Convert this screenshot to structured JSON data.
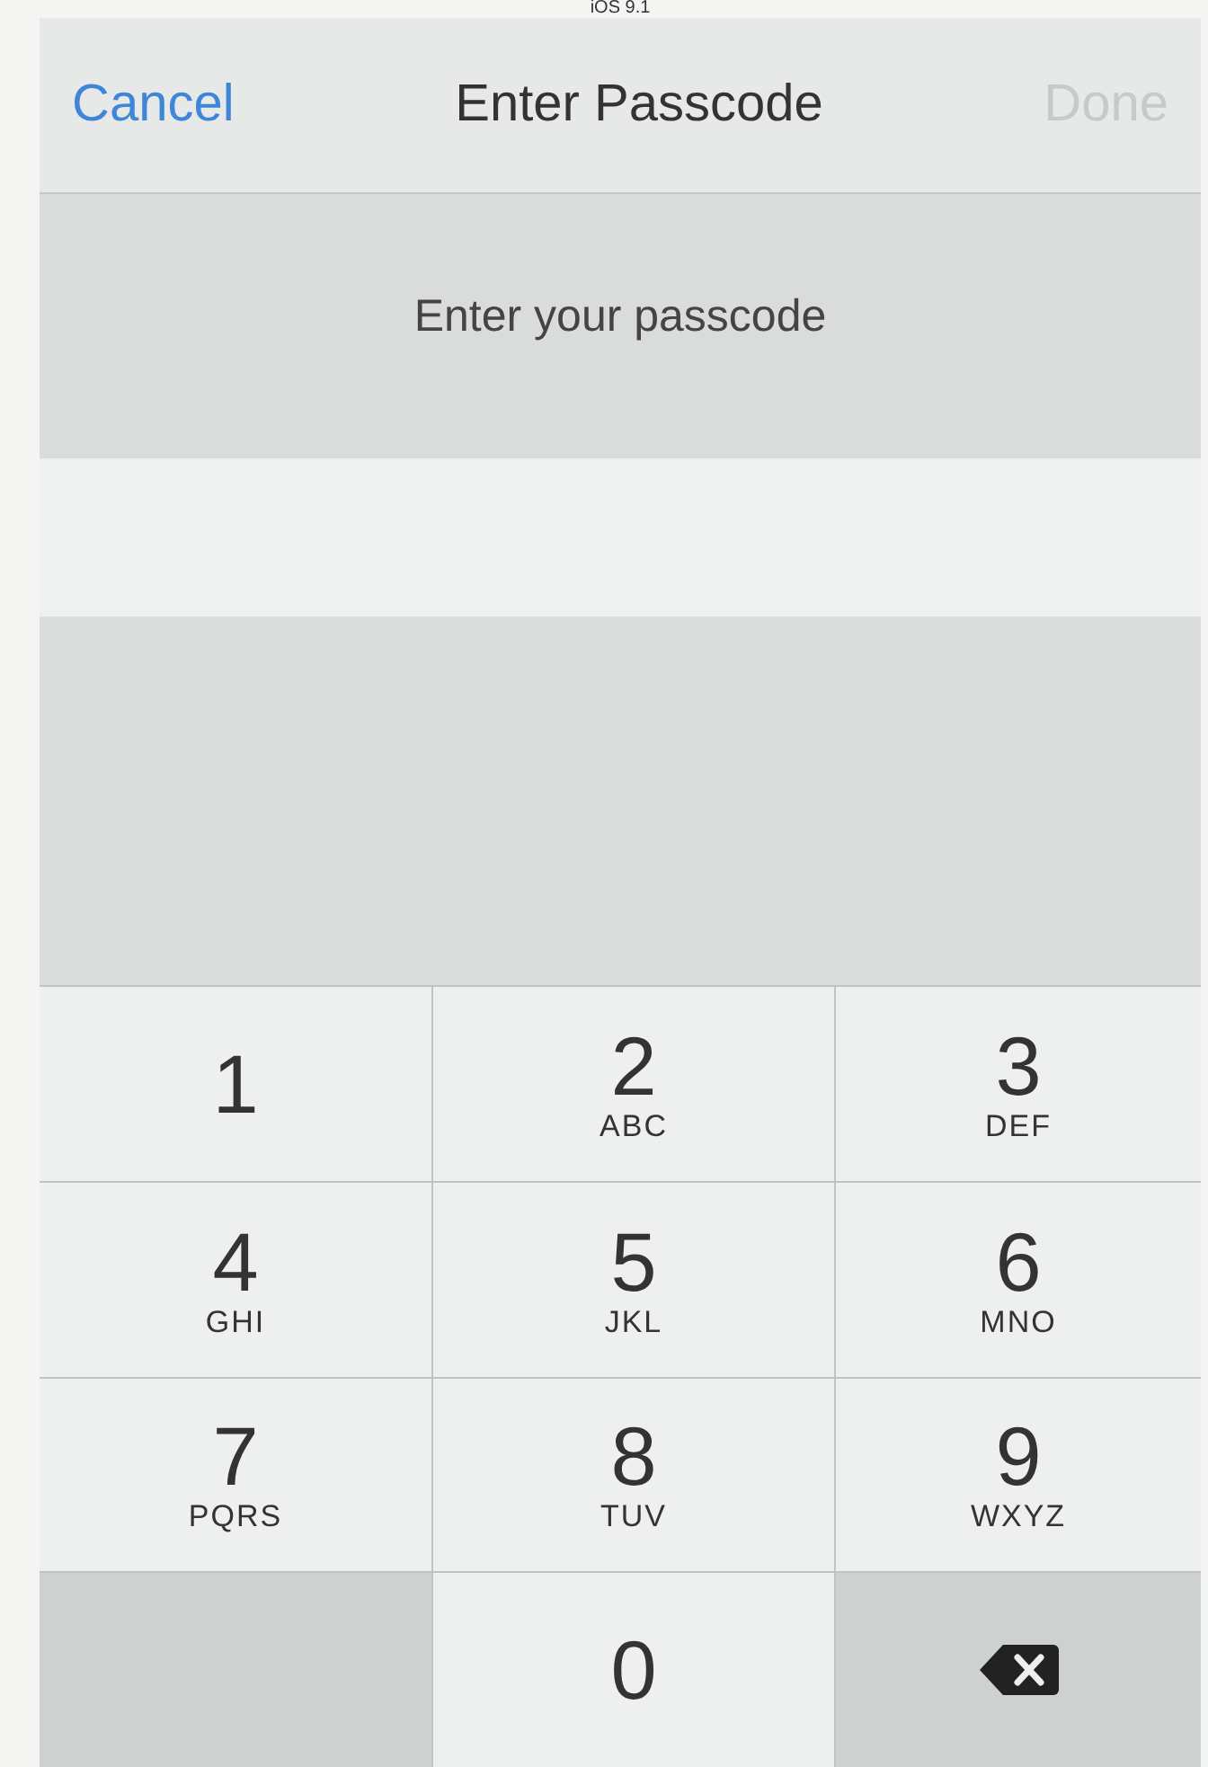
{
  "status_strip": {
    "text": "iOS 9.1"
  },
  "nav": {
    "cancel": "Cancel",
    "title": "Enter Passcode",
    "done": {
      "label": "Done",
      "disabled": true
    }
  },
  "prompt": "Enter your passcode",
  "keypad": [
    {
      "kind": "digit",
      "digit": "1"
    },
    {
      "kind": "digit",
      "digit": "2",
      "letters": "ABC"
    },
    {
      "kind": "digit",
      "digit": "3",
      "letters": "DEF"
    },
    {
      "kind": "digit",
      "digit": "4",
      "letters": "GHI"
    },
    {
      "kind": "digit",
      "digit": "5",
      "letters": "JKL"
    },
    {
      "kind": "digit",
      "digit": "6",
      "letters": "MNO"
    },
    {
      "kind": "digit",
      "digit": "7",
      "letters": "PQRS"
    },
    {
      "kind": "digit",
      "digit": "8",
      "letters": "TUV"
    },
    {
      "kind": "digit",
      "digit": "9",
      "letters": "WXYZ"
    },
    {
      "kind": "blank"
    },
    {
      "kind": "digit",
      "digit": "0"
    },
    {
      "kind": "delete"
    }
  ]
}
